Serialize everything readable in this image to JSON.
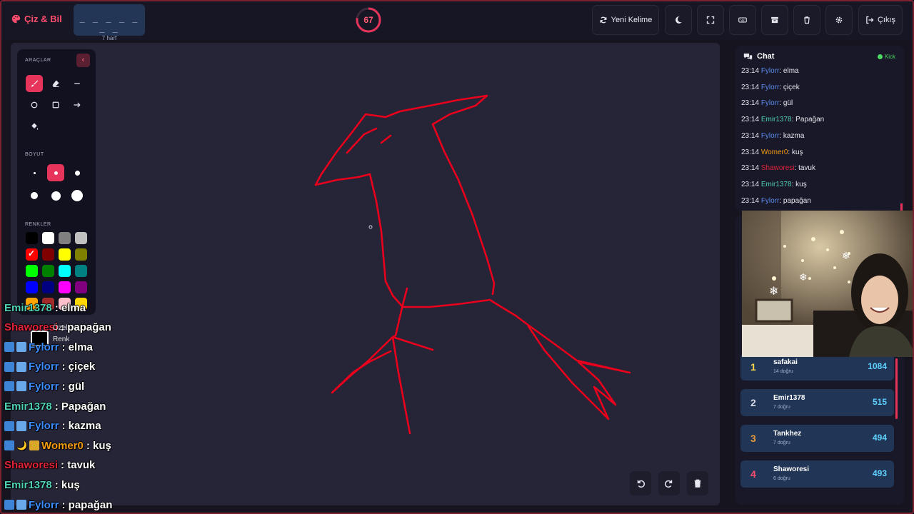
{
  "header": {
    "brand": "Çiz & Bil",
    "word_mask": "_ _ _ _ _ _ _",
    "word_length": "7 harf",
    "timer": "67",
    "buttons": {
      "new_word": "Yeni Kelime",
      "exit": "Çıkış"
    }
  },
  "tools": {
    "section_tools": "ARAÇLAR",
    "section_size": "BOYUT",
    "section_colors": "RENKLER",
    "custom_label": "Özel",
    "custom_sublabel": "Renk",
    "colors": [
      "#000000",
      "#ffffff",
      "#808080",
      "#c0c0c0",
      "#ff0000",
      "#800000",
      "#ffff00",
      "#808000",
      "#00ff00",
      "#008000",
      "#00ffff",
      "#008080",
      "#0000ff",
      "#000080",
      "#ff00ff",
      "#800080",
      "#ffa500",
      "#a52a2a",
      "#ffc0cb",
      "#ffd700"
    ],
    "selected_color": "#ff0000"
  },
  "overlay": [
    {
      "user": "Emir1378",
      "msg": ": elma",
      "color": "#4fd1b5"
    },
    {
      "user": "Shaworesi",
      "msg": ": papağan",
      "color": "#e0243a"
    },
    {
      "user": "Fylorr",
      "msg": ": elma",
      "color": "#3c8dff"
    },
    {
      "user": "Fylorr",
      "msg": ": çiçek",
      "color": "#3c8dff"
    },
    {
      "user": "Fylorr",
      "msg": ": gül",
      "color": "#3c8dff"
    },
    {
      "user": "Emir1378",
      "msg": ": Papağan",
      "color": "#4fd1b5"
    },
    {
      "user": "Fylorr",
      "msg": ": kazma",
      "color": "#3c8dff"
    },
    {
      "user": "Womer0",
      "msg": ": kuş",
      "color": "#f39c12"
    },
    {
      "user": "Shaworesi",
      "msg": ": tavuk",
      "color": "#e0243a"
    },
    {
      "user": "Emir1378",
      "msg": ": kuş",
      "color": "#4fd1b5"
    },
    {
      "user": "Fylorr",
      "msg": ": papağan",
      "color": "#3c8dff"
    }
  ],
  "chat": {
    "title": "Chat",
    "platform": "Kick",
    "messages": [
      {
        "time": "23:14",
        "user": "Fylorr",
        "text": ": elma",
        "color": "#5a8dee"
      },
      {
        "time": "23:14",
        "user": "Fylorr",
        "text": ": çiçek",
        "color": "#5a8dee"
      },
      {
        "time": "23:14",
        "user": "Fylorr",
        "text": ": gül",
        "color": "#5a8dee"
      },
      {
        "time": "23:14",
        "user": "Emir1378",
        "text": ": Papağan",
        "color": "#4fd1b5"
      },
      {
        "time": "23:14",
        "user": "Fylorr",
        "text": ": kazma",
        "color": "#5a8dee"
      },
      {
        "time": "23:14",
        "user": "Womer0",
        "text": ": kuş",
        "color": "#f39c12"
      },
      {
        "time": "23:14",
        "user": "Shaworesi",
        "text": ": tavuk",
        "color": "#e0243a"
      },
      {
        "time": "23:14",
        "user": "Emir1378",
        "text": ": kuş",
        "color": "#4fd1b5"
      },
      {
        "time": "23:14",
        "user": "Fylorr",
        "text": ": papağan",
        "color": "#5a8dee"
      }
    ]
  },
  "leaderboard": [
    {
      "rank": "1",
      "name": "safakai",
      "correct": "14 doğru",
      "score": "1084",
      "rank_color": "#ffd84a"
    },
    {
      "rank": "2",
      "name": "Emir1378",
      "correct": "7 doğru",
      "score": "515",
      "rank_color": "#d6dbe6"
    },
    {
      "rank": "3",
      "name": "Tankhez",
      "correct": "7 doğru",
      "score": "494",
      "rank_color": "#e89a3c"
    },
    {
      "rank": "4",
      "name": "Shaworesi",
      "correct": "6 doğru",
      "score": "493",
      "rank_color": "#ff4d6d"
    }
  ],
  "colors": {
    "accent": "#e7345b",
    "stroke": "#e8001c",
    "panel": "#191828",
    "canvas": "#262537"
  }
}
